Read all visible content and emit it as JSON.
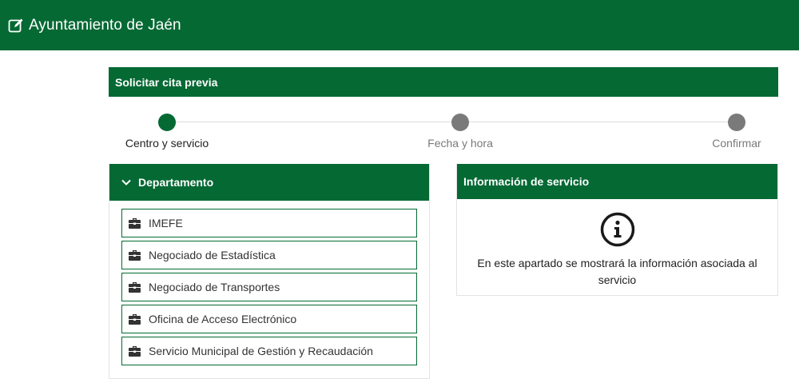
{
  "header": {
    "title": "Ayuntamiento de Jaén",
    "icon": "edit-icon"
  },
  "panel": {
    "title": "Solicitar cita previa"
  },
  "stepper": {
    "steps": [
      {
        "label": "Centro y servicio",
        "active": true
      },
      {
        "label": "Fecha y hora",
        "active": false
      },
      {
        "label": "Confirmar",
        "active": false
      }
    ]
  },
  "departments": {
    "title": "Departamento",
    "items": [
      {
        "label": "IMEFE",
        "icon": "briefcase-icon"
      },
      {
        "label": "Negociado de Estadística",
        "icon": "briefcase-icon"
      },
      {
        "label": "Negociado de Transportes",
        "icon": "briefcase-icon"
      },
      {
        "label": "Oficina de Acceso Electrónico",
        "icon": "briefcase-icon"
      },
      {
        "label": "Servicio Municipal de Gestión y Recaudación",
        "icon": "briefcase-icon"
      }
    ]
  },
  "info": {
    "title": "Información de servicio",
    "message": "En este apartado se mostrará la información asociada al servicio",
    "icon": "info-icon"
  },
  "colors": {
    "brand": "#056934",
    "inactive": "#7a7a7a"
  }
}
